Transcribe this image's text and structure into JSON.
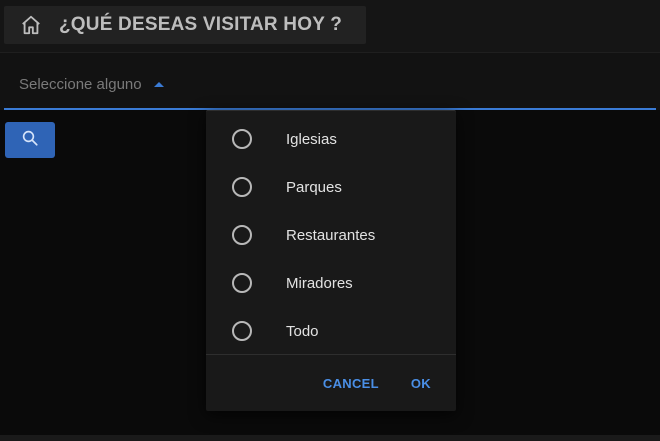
{
  "header": {
    "title": "¿QUÉ DESEAS VISITAR HOY ?",
    "home_icon": "home-icon"
  },
  "select": {
    "placeholder": "Seleccione alguno",
    "caret_icon": "caret-up-icon",
    "accent_color": "#3a7bd5"
  },
  "search_button": {
    "icon": "search-icon",
    "color": "#2f64b6"
  },
  "dialog": {
    "options": [
      {
        "label": "Iglesias",
        "selected": false
      },
      {
        "label": "Parques",
        "selected": false
      },
      {
        "label": "Restaurantes",
        "selected": false
      },
      {
        "label": "Miradores",
        "selected": false
      },
      {
        "label": "Todo",
        "selected": false
      }
    ],
    "cancel_label": "CANCEL",
    "ok_label": "OK"
  }
}
